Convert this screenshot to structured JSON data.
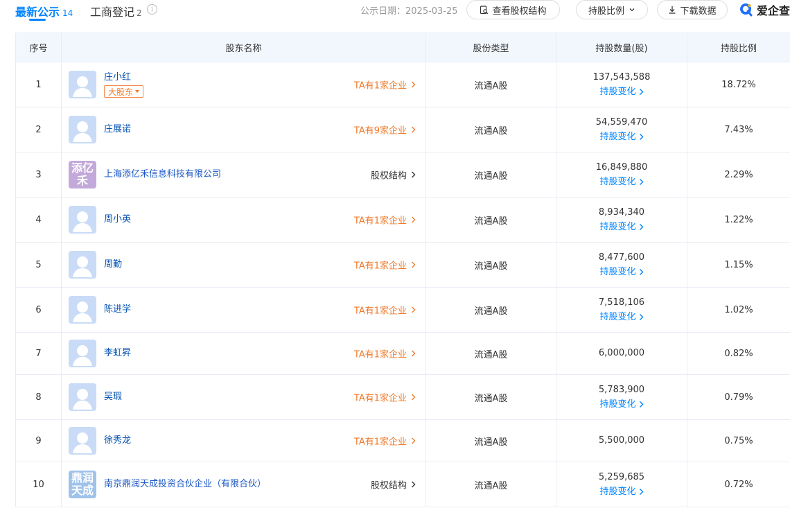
{
  "tabs": [
    {
      "label": "最新公示",
      "count": "14"
    },
    {
      "label": "工商登记",
      "count": "2"
    }
  ],
  "info_icon_glyph": "i",
  "pub_date": "公示日期：2025-03-25",
  "buttons": {
    "structure": "查看股权结构",
    "ratio": "持股比例",
    "download": "下载数据"
  },
  "logo": {
    "text": "爱企查"
  },
  "colors": {
    "accent": "#0084ff",
    "orange": "#f07a2b",
    "header_bg": "#f2f7fe"
  },
  "table": {
    "headers": [
      "序号",
      "股东名称",
      "股份类型",
      "持股数量(股)",
      "持股比例"
    ],
    "rows": [
      {
        "index": "1",
        "name": "庄小红",
        "avatar": "person",
        "badge": "大股东",
        "link": "TA有1家企业",
        "link_style": "orange",
        "type": "流通A股",
        "qty": "137,543,588",
        "change": "持股变化",
        "ratio": "18.72%"
      },
      {
        "index": "2",
        "name": "庄展诺",
        "avatar": "person",
        "badge": "",
        "link": "TA有9家企业",
        "link_style": "orange",
        "type": "流通A股",
        "qty": "54,559,470",
        "change": "持股变化",
        "ratio": "7.43%"
      },
      {
        "index": "3",
        "name": "上海添亿禾信息科技有限公司",
        "avatar": "company",
        "avatar_text": "添亿禾",
        "avatar_color": "#c3a9da",
        "badge": "",
        "link": "股权结构",
        "link_style": "dark",
        "type": "流通A股",
        "qty": "16,849,880",
        "change": "持股变化",
        "ratio": "2.29%"
      },
      {
        "index": "4",
        "name": "周小英",
        "avatar": "person",
        "badge": "",
        "link": "TA有1家企业",
        "link_style": "orange",
        "type": "流通A股",
        "qty": "8,934,340",
        "change": "持股变化",
        "ratio": "1.22%"
      },
      {
        "index": "5",
        "name": "周勤",
        "avatar": "person",
        "badge": "",
        "link": "TA有1家企业",
        "link_style": "orange",
        "type": "流通A股",
        "qty": "8,477,600",
        "change": "持股变化",
        "ratio": "1.15%"
      },
      {
        "index": "6",
        "name": "陈进学",
        "avatar": "person",
        "badge": "",
        "link": "TA有1家企业",
        "link_style": "orange",
        "type": "流通A股",
        "qty": "7,518,106",
        "change": "持股变化",
        "ratio": "1.02%"
      },
      {
        "index": "7",
        "name": "李虹昇",
        "avatar": "person",
        "badge": "",
        "link": "TA有1家企业",
        "link_style": "orange",
        "type": "流通A股",
        "qty": "6,000,000",
        "change": "",
        "ratio": "0.82%"
      },
      {
        "index": "8",
        "name": "吴瑕",
        "avatar": "person",
        "badge": "",
        "link": "TA有1家企业",
        "link_style": "orange",
        "type": "流通A股",
        "qty": "5,783,900",
        "change": "持股变化",
        "ratio": "0.79%"
      },
      {
        "index": "9",
        "name": "徐秀龙",
        "avatar": "person",
        "badge": "",
        "link": "TA有1家企业",
        "link_style": "orange",
        "type": "流通A股",
        "qty": "5,500,000",
        "change": "",
        "ratio": "0.75%"
      },
      {
        "index": "10",
        "name": "南京鼎润天成投资合伙企业（有限合伙）",
        "avatar": "company",
        "avatar_text": "鼎润天成",
        "avatar_color": "#9fc2ea",
        "badge": "",
        "link": "股权结构",
        "link_style": "dark",
        "type": "流通A股",
        "qty": "5,259,685",
        "change": "持股变化",
        "ratio": "0.72%"
      }
    ]
  }
}
